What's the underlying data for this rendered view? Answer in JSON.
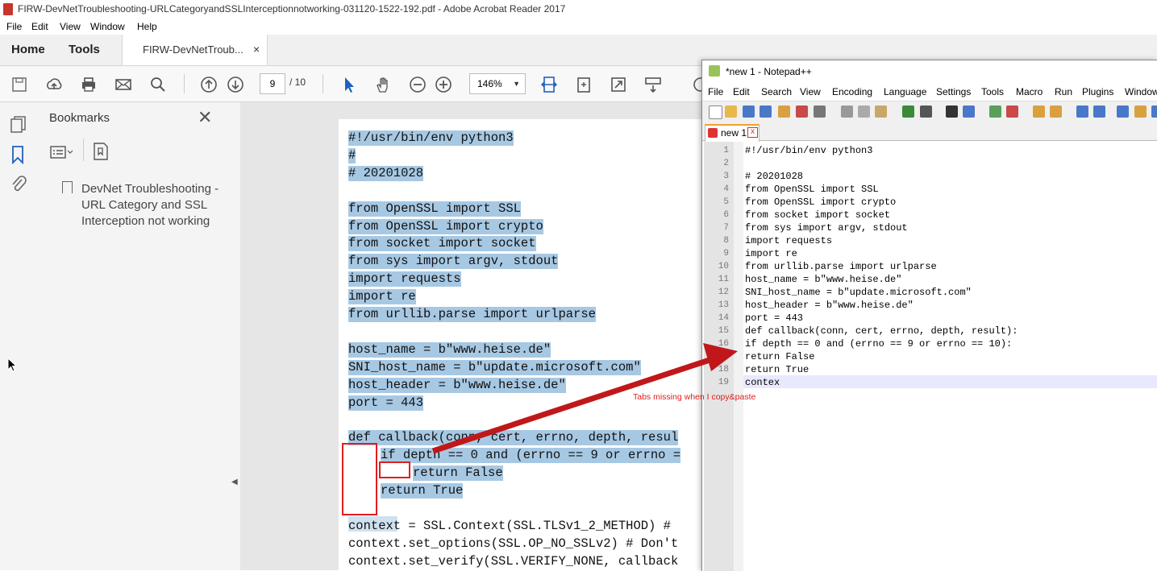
{
  "acrobat": {
    "window_title": "FIRW-DevNetTroubleshooting-URLCategoryandSSLInterceptionnotworking-031120-1522-192.pdf - Adobe Acrobat Reader 2017",
    "menu": [
      "File",
      "Edit",
      "View",
      "Window",
      "Help"
    ],
    "tabs": {
      "home": "Home",
      "tools": "Tools",
      "document": "FIRW-DevNetTroub...",
      "document_close": "×"
    },
    "toolbar": {
      "page_current": "9",
      "page_total": "/ 10",
      "zoom": "146%",
      "icons": [
        "save-icon",
        "upload-icon",
        "print-icon",
        "email-icon",
        "search-icon",
        "page-up-icon",
        "page-down-icon",
        "select-cursor-icon",
        "hand-icon",
        "zoom-out-icon",
        "zoom-in-icon",
        "fit-width-icon",
        "rotate-icon",
        "fullscreen-icon",
        "scroll-mode-icon",
        "comment-icon"
      ]
    },
    "bookmarks": {
      "header": "Bookmarks",
      "close": "✕",
      "item": "DevNet Troubleshooting - URL Category and SSL Interception not working"
    },
    "pdf_lines": [
      "#!/usr/bin/env python3",
      "#",
      "# 20201028",
      "",
      "from OpenSSL import SSL",
      "from OpenSSL import crypto",
      "from socket import socket",
      "from sys import argv, stdout",
      "import requests",
      "import re",
      "from urllib.parse import urlparse",
      "",
      "host_name = b\"www.heise.de\"",
      "SNI_host_name = b\"update.microsoft.com\"",
      "host_header = b\"www.heise.de\"",
      "port = 443",
      "",
      "def callback(conn, cert, errno, depth, resul",
      "    if depth == 0 and (errno == 9 or errno =",
      "        return False",
      "    return True",
      "",
      "context = SSL.Context(SSL.TLSv1_2_METHOD) #",
      "context.set_options(SSL.OP_NO_SSLv2) # Don't",
      "context.set_verify(SSL.VERIFY_NONE, callback"
    ]
  },
  "notepad": {
    "window_title": "*new 1 - Notepad++",
    "menu": [
      "File",
      "Edit",
      "Search",
      "View",
      "Encoding",
      "Language",
      "Settings",
      "Tools",
      "Macro",
      "Run",
      "Plugins",
      "Window"
    ],
    "tab": {
      "label": "new 1",
      "close": "x"
    },
    "lines": [
      {
        "n": "1",
        "t": "#!/usr/bin/env python3"
      },
      {
        "n": "2",
        "t": ""
      },
      {
        "n": "3",
        "t": "# 20201028"
      },
      {
        "n": "4",
        "t": "from OpenSSL import SSL"
      },
      {
        "n": "5",
        "t": "from OpenSSL import crypto"
      },
      {
        "n": "6",
        "t": "from socket import socket"
      },
      {
        "n": "7",
        "t": "from sys import argv, stdout"
      },
      {
        "n": "8",
        "t": "import requests"
      },
      {
        "n": "9",
        "t": "import re"
      },
      {
        "n": "10",
        "t": "from urllib.parse import urlparse"
      },
      {
        "n": "11",
        "t": "host_name = b\"www.heise.de\""
      },
      {
        "n": "12",
        "t": "SNI_host_name = b\"update.microsoft.com\""
      },
      {
        "n": "13",
        "t": "host_header = b\"www.heise.de\""
      },
      {
        "n": "14",
        "t": "port = 443"
      },
      {
        "n": "15",
        "t": "def callback(conn, cert, errno, depth, result):"
      },
      {
        "n": "16",
        "t": "if depth == 0 and (errno == 9 or errno == 10):"
      },
      {
        "n": "17",
        "t": "return False"
      },
      {
        "n": "18",
        "t": "return True"
      },
      {
        "n": "19",
        "t": "contex"
      }
    ]
  },
  "annotation": {
    "text": "Tabs missing when I copy&paste",
    "color": "#e01e1e"
  }
}
